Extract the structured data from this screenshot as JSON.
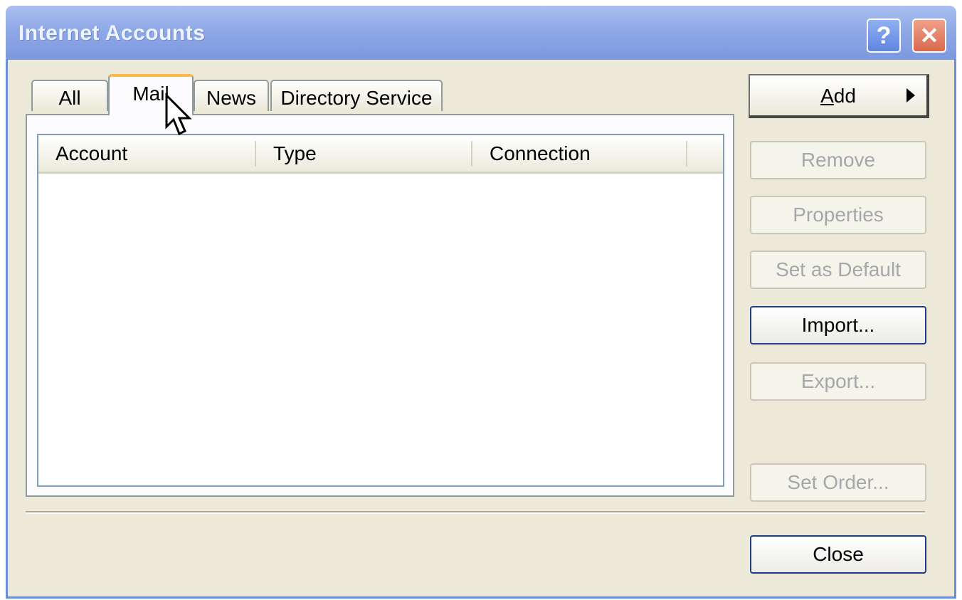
{
  "window": {
    "title": "Internet Accounts",
    "help_label": "?",
    "close_glyph": "✕"
  },
  "tabs": [
    {
      "label": "All",
      "active": false
    },
    {
      "label": "Mail",
      "active": true
    },
    {
      "label": "News",
      "active": false
    },
    {
      "label": "Directory Service",
      "active": false
    }
  ],
  "list": {
    "columns": [
      "Account",
      "Type",
      "Connection"
    ],
    "rows": []
  },
  "buttons": {
    "add": {
      "label_prefix": "A",
      "label_rest": "dd",
      "enabled": true
    },
    "remove": {
      "label": "Remove",
      "enabled": false
    },
    "properties": {
      "label": "Properties",
      "enabled": false
    },
    "set_default": {
      "label": "Set as Default",
      "enabled": false
    },
    "import": {
      "label": "Import...",
      "enabled": true
    },
    "export": {
      "label": "Export...",
      "enabled": false
    },
    "set_order": {
      "label": "Set Order...",
      "enabled": false
    },
    "close": {
      "label": "Close",
      "enabled": true
    }
  },
  "colors": {
    "titlebar": "#8fa9e6",
    "dialog_bg": "#ece9d8",
    "active_tab_accent": "#f9b84a"
  },
  "icons": [
    "help-icon",
    "close-icon",
    "arrow-right-icon",
    "mouse-cursor-icon"
  ]
}
